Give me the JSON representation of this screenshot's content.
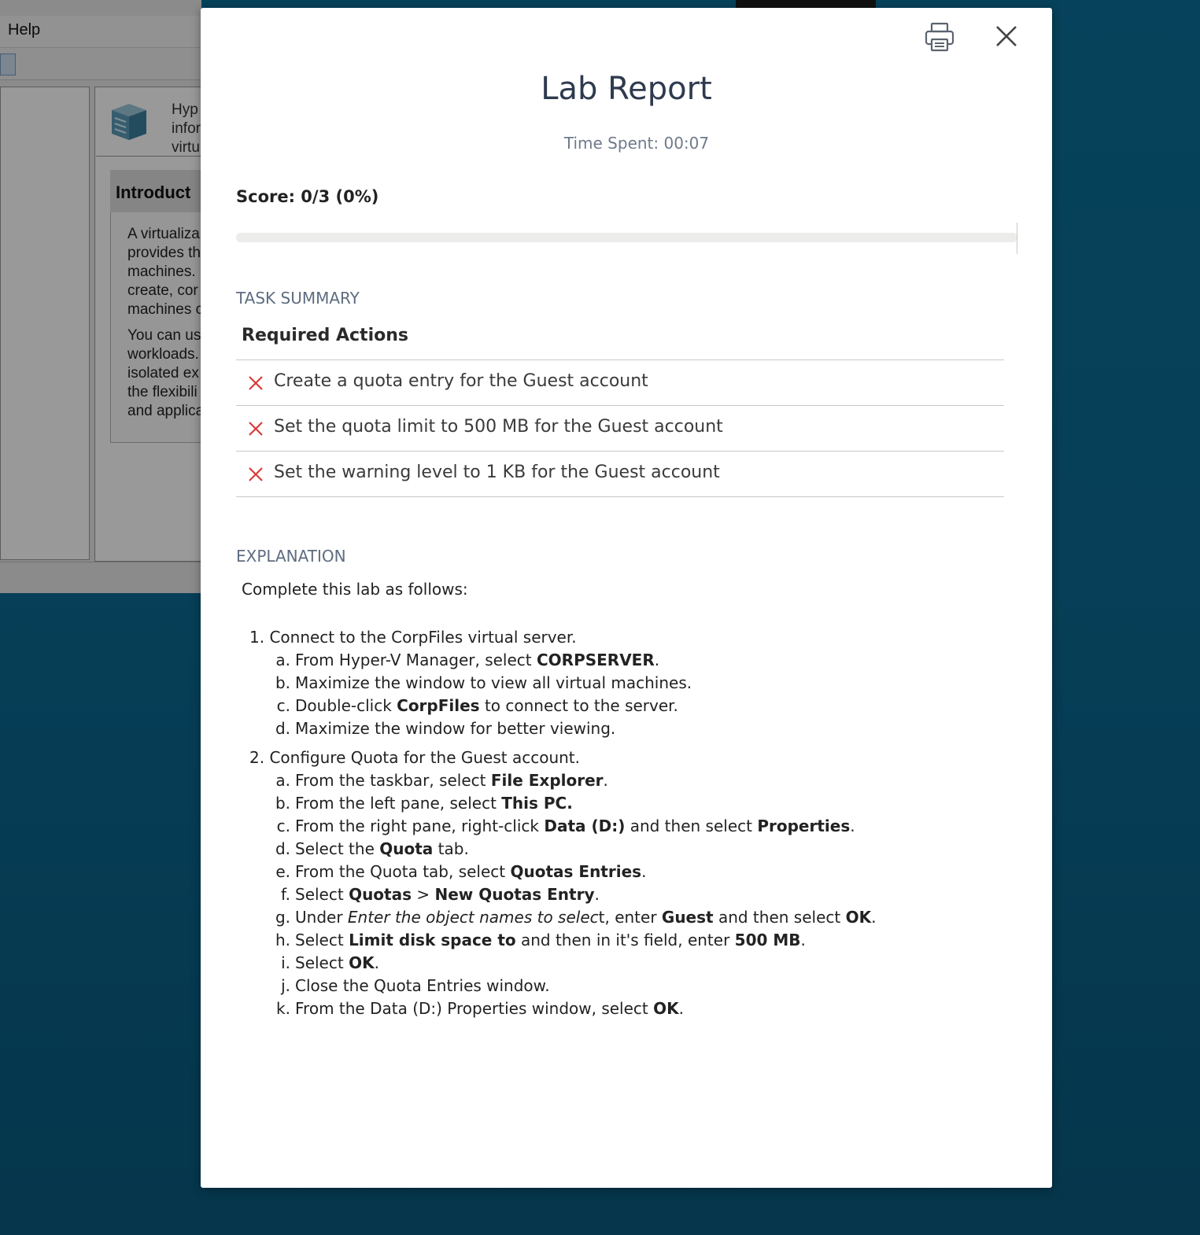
{
  "background_app": {
    "menu_help": "Help",
    "header_text": "Hyp\ninfor\nvirtu",
    "intro_title": "Introduct",
    "paragraph1": "A virtualiza\nprovides th\nmachines.\ncreate, cor\nmachines c",
    "paragraph2": "You can us\nworkloads.\nisolated ex\nthe flexibili\nand applica"
  },
  "modal": {
    "title": "Lab Report",
    "time_spent": "Time Spent: 00:07",
    "score": "Score: 0/3 (0%)",
    "progress_fraction": 0.0,
    "task_summary_heading": "TASK SUMMARY",
    "required_heading": "Required Actions",
    "actions": [
      {
        "text": "Create a quota entry for the Guest account",
        "status": "failed"
      },
      {
        "text": "Set the quota limit to 500 MB for the Guest account",
        "status": "failed"
      },
      {
        "text": "Set the warning level to 1 KB for the Guest account",
        "status": "failed"
      }
    ],
    "explanation_heading": "EXPLANATION",
    "explanation_intro": "Complete this lab as follows:",
    "steps": [
      {
        "number": "1.",
        "title": "Connect to the CorpFiles virtual server.",
        "items": [
          {
            "letter": "a.",
            "html": "From Hyper-V Manager, select <b>CORPSERVER</b>."
          },
          {
            "letter": "b.",
            "html": "Maximize the window to view all virtual machines."
          },
          {
            "letter": "c.",
            "html": "Double-click <b>CorpFiles</b> to connect to the server."
          },
          {
            "letter": "d.",
            "html": "Maximize the window for better viewing."
          }
        ]
      },
      {
        "number": "2.",
        "title": "Configure Quota for the Guest account.",
        "items": [
          {
            "letter": "a.",
            "html": "From the taskbar, select <b>File Explorer</b>."
          },
          {
            "letter": "b.",
            "html": "From the left pane, select <b>This PC.</b>"
          },
          {
            "letter": "c.",
            "html": "From the right pane, right-click <b>Data (D:)</b> and then select <b>Properties</b>."
          },
          {
            "letter": "d.",
            "html": "Select the <b>Quota</b> tab."
          },
          {
            "letter": "e.",
            "html": "From the Quota tab, select <b>Quotas Entries</b>."
          },
          {
            "letter": "f.",
            "html": "Select <b>Quotas</b> &gt; <b>New Quotas Entry</b>."
          },
          {
            "letter": "g.",
            "html": "Under <i>Enter the object names to selec</i>t, enter <b>Guest</b> and then select <b>OK</b>."
          },
          {
            "letter": "h.",
            "html": "Select <b>Limit disk space to</b> and then in it's field, enter <b>500 MB</b>."
          },
          {
            "letter": "i.",
            "html": "Select <b>OK</b>."
          },
          {
            "letter": "j.",
            "html": "Close the Quota Entries window."
          },
          {
            "letter": "k.",
            "html": "From the Data (D:) Properties window, select <b>OK</b>."
          }
        ]
      }
    ]
  },
  "colors": {
    "fail_icon": "#d93a3a",
    "desktop": "#0a6f98",
    "title": "#2e3a4e",
    "heading_muted": "#5e6d80"
  },
  "icons": {
    "print": "printer-icon",
    "close": "close-icon",
    "fail": "x-mark-icon"
  }
}
